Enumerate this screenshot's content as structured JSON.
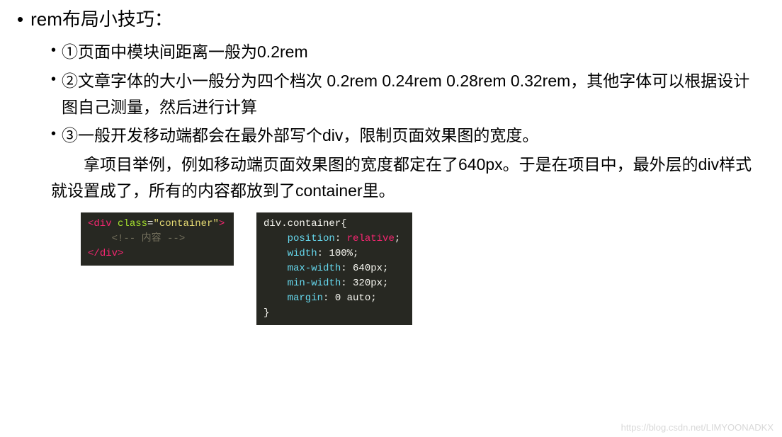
{
  "title": "rem布局小技巧：",
  "items": [
    "①页面中模块间距离一般为0.2rem",
    "②文章字体的大小一般分为四个档次 0.2rem 0.24rem 0.28rem 0.32rem，其他字体可以根据设计图自己测量，然后进行计算",
    "③一般开发移动端都会在最外部写个div，限制页面效果图的宽度。"
  ],
  "paragraph": "拿项目举例，例如移动端页面效果图的宽度都定在了640px。于是在项目中，最外层的div样式就设置成了，所有的内容都放到了container里。",
  "code1": {
    "line1_open": "<",
    "line1_tag": "div",
    "line1_attr": " class",
    "line1_eq": "=",
    "line1_str": "\"container\"",
    "line1_close": ">",
    "line2": "    <!-- 内容 -->",
    "line3_open": "</",
    "line3_tag": "div",
    "line3_close": ">"
  },
  "code2": {
    "line1": "div.container{",
    "line2_prop": "    position",
    "line2_sep": ": ",
    "line2_val": "relative",
    "line2_end": ";",
    "line3_prop": "    width",
    "line3_sep": ": ",
    "line3_val": "100%",
    "line3_end": ";",
    "line4_prop": "    max-width",
    "line4_sep": ": ",
    "line4_val": "640px",
    "line4_end": ";",
    "line5_prop": "    min-width",
    "line5_sep": ": ",
    "line5_val": "320px",
    "line5_end": ";",
    "line6_prop": "    margin",
    "line6_sep": ": ",
    "line6_val": "0 auto",
    "line6_end": ";",
    "line7": "}"
  },
  "watermark": "https://blog.csdn.net/LIMYOONADKX"
}
